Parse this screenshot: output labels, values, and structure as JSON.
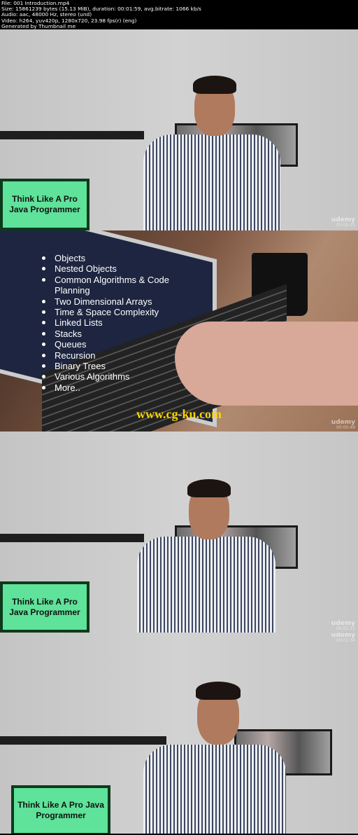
{
  "header": {
    "lines": [
      "File: 001 Introduction.mp4",
      "Size: 15861239 bytes (15.13 MiB), duration: 00:01:59, avg.bitrate: 1066 kb/s",
      "Audio: aac, 48000 Hz, stereo (und)",
      "Video: h264, yuv420p, 1280x720, 23.98 fps(r) (eng)",
      "Generated by Thumbnail me"
    ]
  },
  "frames": [
    {
      "sign": "Think Like A Pro Java Programmer",
      "brand": "udemy",
      "time": "00:00:25"
    },
    {
      "bullets": [
        "Objects",
        "Nested Objects",
        "Common Algorithms & Code",
        "Planning",
        "Two Dimensional Arrays",
        "Time & Space Complexity",
        "Linked Lists",
        "Stacks",
        "Queues",
        "Recursion",
        "Binary Trees",
        "Various Algorithms",
        "More.."
      ],
      "watermark": "www.cg-ku.com",
      "brand": "udemy",
      "time": "00:00:49"
    },
    {
      "sign": "Think Like A Pro Java Programmer",
      "brand": "udemy",
      "time": "00:01:11"
    },
    {
      "sign": "Think Like A Pro Java Programmer",
      "brand": "udemy",
      "time": "00:01:34"
    }
  ]
}
